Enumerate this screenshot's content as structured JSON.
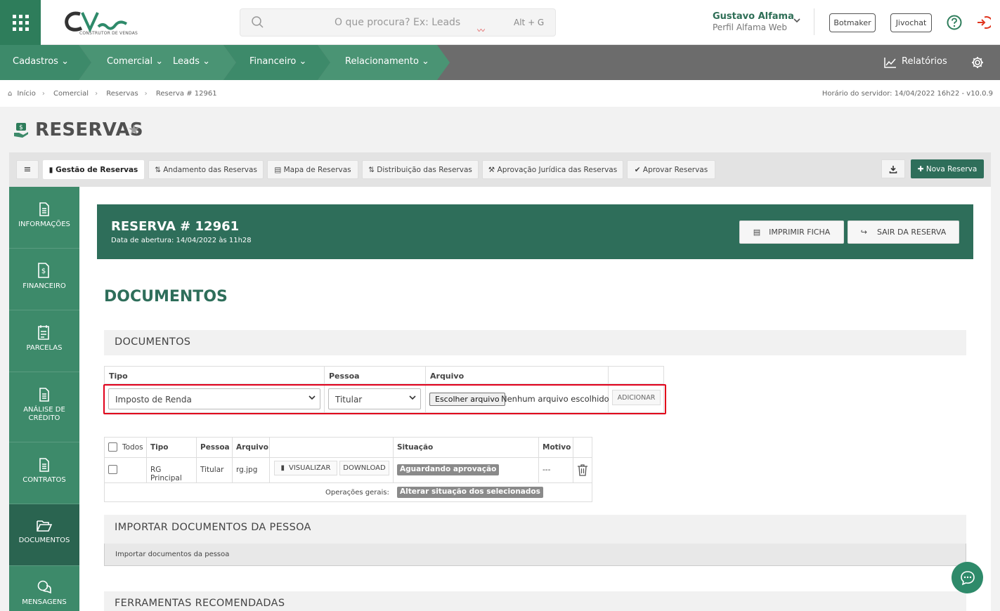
{
  "header": {
    "logo_subtitle": "CONSTRUTOR DE VENDAS",
    "search_placeholder": "O que procura? Ex: Leads",
    "search_shortcut": "Alt + G",
    "user_name": "Gustavo Alfama",
    "user_profile": "Perfil Alfama Web",
    "botmaker_label": "Botmaker",
    "jivochat_label": "Jivochat"
  },
  "nav": {
    "items": [
      "Cadastros",
      "Comercial",
      "Leads",
      "Financeiro",
      "Relacionamento"
    ],
    "reports_label": "Relatórios"
  },
  "breadcrumb": {
    "items": [
      "Início",
      "Comercial",
      "Reservas",
      "Reserva # 12961"
    ],
    "server_time": "Horário do servidor: 14/04/2022 16h22 - v10.0.9"
  },
  "page": {
    "title": "RESERVAS"
  },
  "tabs": [
    "Gestão de Reservas",
    "Andamento das Reservas",
    "Mapa de Reservas",
    "Distribuição das Reservas",
    "Aprovação Jurídica das Reservas",
    "Aprovar Reservas"
  ],
  "new_reservation_label": "Nova Reserva",
  "sidebar": {
    "items": [
      "INFORMAÇÕES",
      "FINANCEIRO",
      "PARCELAS",
      "ANÁLISE DE CRÉDITO",
      "CONTRATOS",
      "DOCUMENTOS",
      "MENSAGENS"
    ]
  },
  "reservation": {
    "title": "RESERVA # 12961",
    "opened": "Data de abertura: 14/04/2022 às 11h28",
    "print_label": "IMPRIMIR FICHA",
    "exit_label": "SAIR DA RESERVA"
  },
  "documents": {
    "section_title": "DOCUMENTOS",
    "panel_title": "DOCUMENTOS",
    "upload": {
      "headers": [
        "Tipo",
        "Pessoa",
        "Arquivo"
      ],
      "tipo_value": "Imposto de Renda",
      "pessoa_value": "Titular",
      "file_button": "Escolher arquivo",
      "file_status": "Nenhum arquivo escolhido",
      "add_label": "ADICIONAR"
    },
    "list": {
      "headers": [
        "Todos",
        "Tipo",
        "Pessoa",
        "Arquivo",
        "Situação",
        "Motivo"
      ],
      "rows": [
        {
          "tipo": "RG Principal",
          "pessoa": "Titular",
          "arquivo": "rg.jpg",
          "situacao": "Aguardando aprovação",
          "motivo": "---"
        }
      ],
      "view_label": "VISUALIZAR",
      "download_label": "DOWNLOAD",
      "general_ops_label": "Operações gerais:",
      "change_status_label": "Alterar situação dos selecionados"
    }
  },
  "import_panel": {
    "title": "IMPORTAR DOCUMENTOS DA PESSOA",
    "row_text": "Importar documentos da pessoa"
  },
  "tools_panel": {
    "title": "FERRAMENTAS RECOMENDADAS"
  },
  "colors": {
    "brand_dark": "#2e6e5a",
    "brand": "#3d8a6a",
    "highlight": "#e1001a"
  }
}
